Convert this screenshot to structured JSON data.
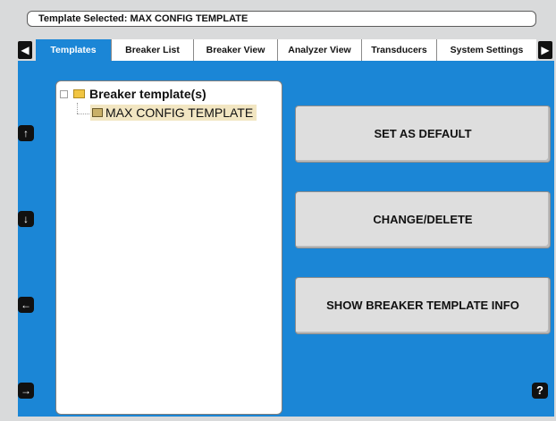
{
  "header": {
    "title": "Template Selected: MAX CONFIG TEMPLATE"
  },
  "tabs": [
    {
      "label": "Templates",
      "active": true
    },
    {
      "label": "Breaker List",
      "active": false
    },
    {
      "label": "Breaker View",
      "active": false
    },
    {
      "label": "Analyzer View",
      "active": false
    },
    {
      "label": "Transducers",
      "active": false
    },
    {
      "label": "System Settings",
      "active": false
    }
  ],
  "tab_nav": {
    "left_icon": "triangle-left-icon",
    "right_icon": "triangle-right-icon"
  },
  "tree": {
    "root_label": "Breaker template(s)",
    "child_label": "MAX CONFIG TEMPLATE"
  },
  "nav_buttons": {
    "up": "↑",
    "down": "↓",
    "left": "←",
    "right": "→"
  },
  "actions": {
    "set_default": "SET AS DEFAULT",
    "change_delete": "CHANGE/DELETE",
    "show_info": "SHOW BREAKER TEMPLATE INFO"
  },
  "help": {
    "label": "?"
  },
  "colors": {
    "accent": "#1b86d6",
    "panel_bg": "#1b86d6",
    "button_bg": "#dedede",
    "selection_bg": "#f2e6c2"
  }
}
